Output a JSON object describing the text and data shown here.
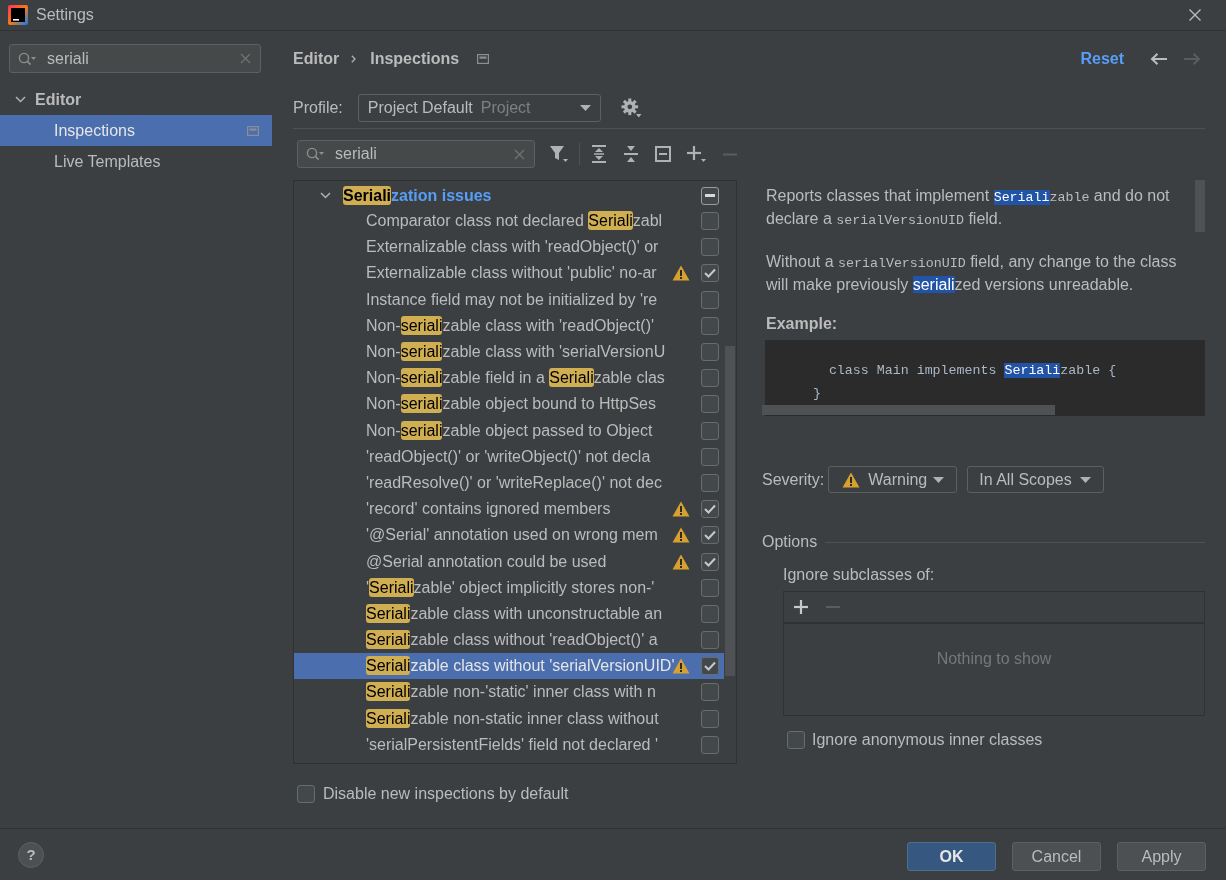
{
  "window": {
    "title": "Settings"
  },
  "sidebar": {
    "search": {
      "value": "seriali"
    },
    "tree": [
      {
        "label": "Editor",
        "expanded": true,
        "selected": false,
        "children": [
          {
            "label": "Inspections",
            "selected": true,
            "project_level": true
          },
          {
            "label": "Live Templates",
            "selected": false,
            "project_level": false
          }
        ]
      }
    ]
  },
  "breadcrumb": {
    "items": [
      "Editor",
      "Inspections"
    ],
    "project_level": true
  },
  "header_actions": {
    "reset": "Reset",
    "nav": [
      {
        "kind": "back",
        "disabled": false
      },
      {
        "kind": "forward",
        "disabled": true
      }
    ]
  },
  "profile": {
    "label": "Profile:",
    "value": "Project Default",
    "scope": "Project"
  },
  "filter": {
    "search": {
      "value": "seriali"
    },
    "tools": [
      {
        "kind": "filter",
        "disabled": false
      },
      {
        "kind": "expand-all",
        "disabled": false
      },
      {
        "kind": "collapse-all",
        "disabled": false
      },
      {
        "kind": "box-minus",
        "disabled": false
      },
      {
        "kind": "add",
        "disabled": false
      },
      {
        "kind": "remove",
        "disabled": true
      }
    ]
  },
  "inspections": {
    "tree": [
      {
        "segments": [
          {
            "text": "Seriali",
            "match": true
          },
          {
            "text": "zation issues",
            "match": false
          }
        ],
        "expanded": true,
        "selected": false,
        "indeterminate": true,
        "children": [
          {
            "segments": [
              {
                "text": "Comparator class not declared ",
                "match": false
              },
              {
                "text": "Seriali",
                "match": true
              },
              {
                "text": "zabl",
                "match": false
              }
            ],
            "severity_icon": false,
            "checked": false,
            "selected": false
          },
          {
            "segments": [
              {
                "text": "Externalizable class with 'readObject()' or",
                "match": false
              }
            ],
            "severity_icon": false,
            "checked": false,
            "selected": false
          },
          {
            "segments": [
              {
                "text": "Externalizable class without 'public' no-ar",
                "match": false
              }
            ],
            "severity_icon": true,
            "checked": true,
            "selected": false
          },
          {
            "segments": [
              {
                "text": "Instance field may not be initialized by 're",
                "match": false
              }
            ],
            "severity_icon": false,
            "checked": false,
            "selected": false
          },
          {
            "segments": [
              {
                "text": "Non-",
                "match": false
              },
              {
                "text": "seriali",
                "match": true
              },
              {
                "text": "zable class with 'readObject()'",
                "match": false
              }
            ],
            "severity_icon": false,
            "checked": false,
            "selected": false
          },
          {
            "segments": [
              {
                "text": "Non-",
                "match": false
              },
              {
                "text": "seriali",
                "match": true
              },
              {
                "text": "zable class with 'serialVersionU",
                "match": false
              }
            ],
            "severity_icon": false,
            "checked": false,
            "selected": false
          },
          {
            "segments": [
              {
                "text": "Non-",
                "match": false
              },
              {
                "text": "seriali",
                "match": true
              },
              {
                "text": "zable field in a ",
                "match": false
              },
              {
                "text": "Seriali",
                "match": true
              },
              {
                "text": "zable clas",
                "match": false
              }
            ],
            "severity_icon": false,
            "checked": false,
            "selected": false
          },
          {
            "segments": [
              {
                "text": "Non-",
                "match": false
              },
              {
                "text": "seriali",
                "match": true
              },
              {
                "text": "zable object bound to HttpSes",
                "match": false
              }
            ],
            "severity_icon": false,
            "checked": false,
            "selected": false
          },
          {
            "segments": [
              {
                "text": "Non-",
                "match": false
              },
              {
                "text": "seriali",
                "match": true
              },
              {
                "text": "zable object passed to Object",
                "match": false
              }
            ],
            "severity_icon": false,
            "checked": false,
            "selected": false
          },
          {
            "segments": [
              {
                "text": "'readObject()' or 'writeObject()' not decla",
                "match": false
              }
            ],
            "severity_icon": false,
            "checked": false,
            "selected": false
          },
          {
            "segments": [
              {
                "text": "'readResolve()' or 'writeReplace()' not dec",
                "match": false
              }
            ],
            "severity_icon": false,
            "checked": false,
            "selected": false
          },
          {
            "segments": [
              {
                "text": "'record' contains ignored members",
                "match": false
              }
            ],
            "severity_icon": true,
            "checked": true,
            "selected": false
          },
          {
            "segments": [
              {
                "text": "'@Serial' annotation used on wrong mem",
                "match": false
              }
            ],
            "severity_icon": true,
            "checked": true,
            "selected": false
          },
          {
            "segments": [
              {
                "text": "@Serial annotation could be used",
                "match": false
              }
            ],
            "severity_icon": true,
            "checked": true,
            "selected": false
          },
          {
            "segments": [
              {
                "text": "'",
                "match": false
              },
              {
                "text": "Seriali",
                "match": true
              },
              {
                "text": "zable' object implicitly stores non-'",
                "match": false
              }
            ],
            "severity_icon": false,
            "checked": false,
            "selected": false
          },
          {
            "segments": [
              {
                "text": "Seriali",
                "match": true
              },
              {
                "text": "zable class with unconstructable an",
                "match": false
              }
            ],
            "severity_icon": false,
            "checked": false,
            "selected": false
          },
          {
            "segments": [
              {
                "text": "Seriali",
                "match": true
              },
              {
                "text": "zable class without 'readObject()' a",
                "match": false
              }
            ],
            "severity_icon": false,
            "checked": false,
            "selected": false
          },
          {
            "segments": [
              {
                "text": "Seriali",
                "match": true
              },
              {
                "text": "zable class without 'serialVersionUID'",
                "match": false
              }
            ],
            "severity_icon": true,
            "checked": true,
            "selected": true
          },
          {
            "segments": [
              {
                "text": "Seriali",
                "match": true
              },
              {
                "text": "zable non-'static' inner class with n",
                "match": false
              }
            ],
            "severity_icon": false,
            "checked": false,
            "selected": false
          },
          {
            "segments": [
              {
                "text": "Seriali",
                "match": true
              },
              {
                "text": "zable non-static inner class without",
                "match": false
              }
            ],
            "severity_icon": false,
            "checked": false,
            "selected": false
          },
          {
            "segments": [
              {
                "text": "'serialPersistentFields' field not declared '",
                "match": false
              }
            ],
            "severity_icon": false,
            "checked": false,
            "selected": false
          }
        ]
      }
    ]
  },
  "description": {
    "paragraphs": [
      [
        {
          "text": "Reports classes that implement ",
          "code": false,
          "match": false
        },
        {
          "text": "Seriali",
          "code": true,
          "match": true
        },
        {
          "text": "zable",
          "code": true,
          "match": false
        },
        {
          "text": " and do not declare a ",
          "code": false,
          "match": false
        },
        {
          "text": "serialVersionUID",
          "code": true,
          "match": false
        },
        {
          "text": " field.",
          "code": false,
          "match": false
        }
      ],
      [
        {
          "text": "Without a ",
          "code": false,
          "match": false
        },
        {
          "text": "serialVersionUID",
          "code": true,
          "match": false
        },
        {
          "text": " field, any change to the class will make previously ",
          "code": false,
          "match": false
        },
        {
          "text": "seriali",
          "code": false,
          "match": true
        },
        {
          "text": "zed versions unreadable.",
          "code": false,
          "match": false
        }
      ]
    ],
    "example_label": "Example:",
    "code_lines": [
      [
        {
          "text": "      class Main implements ",
          "match": false
        },
        {
          "text": "Seriali",
          "match": true
        },
        {
          "text": "zable {",
          "match": false
        }
      ],
      [
        {
          "text": "    }",
          "match": false
        }
      ]
    ]
  },
  "severity": {
    "label": "Severity:",
    "value": "Warning",
    "scope": "In All Scopes"
  },
  "options": {
    "title": "Options",
    "list_label": "Ignore subclasses of:",
    "list_tools": [
      {
        "kind": "add",
        "disabled": false
      },
      {
        "kind": "remove",
        "disabled": true
      }
    ],
    "empty_text": "Nothing to show",
    "checkbox": {
      "label": "Ignore anonymous inner classes",
      "checked": false
    }
  },
  "bottom_checkbox": {
    "label": "Disable new inspections by default",
    "checked": false
  },
  "footer": {
    "help": "?",
    "buttons": [
      {
        "label": "OK",
        "kind": "ok"
      },
      {
        "label": "Cancel",
        "kind": "cancel"
      },
      {
        "label": "Apply",
        "kind": "apply"
      }
    ]
  }
}
